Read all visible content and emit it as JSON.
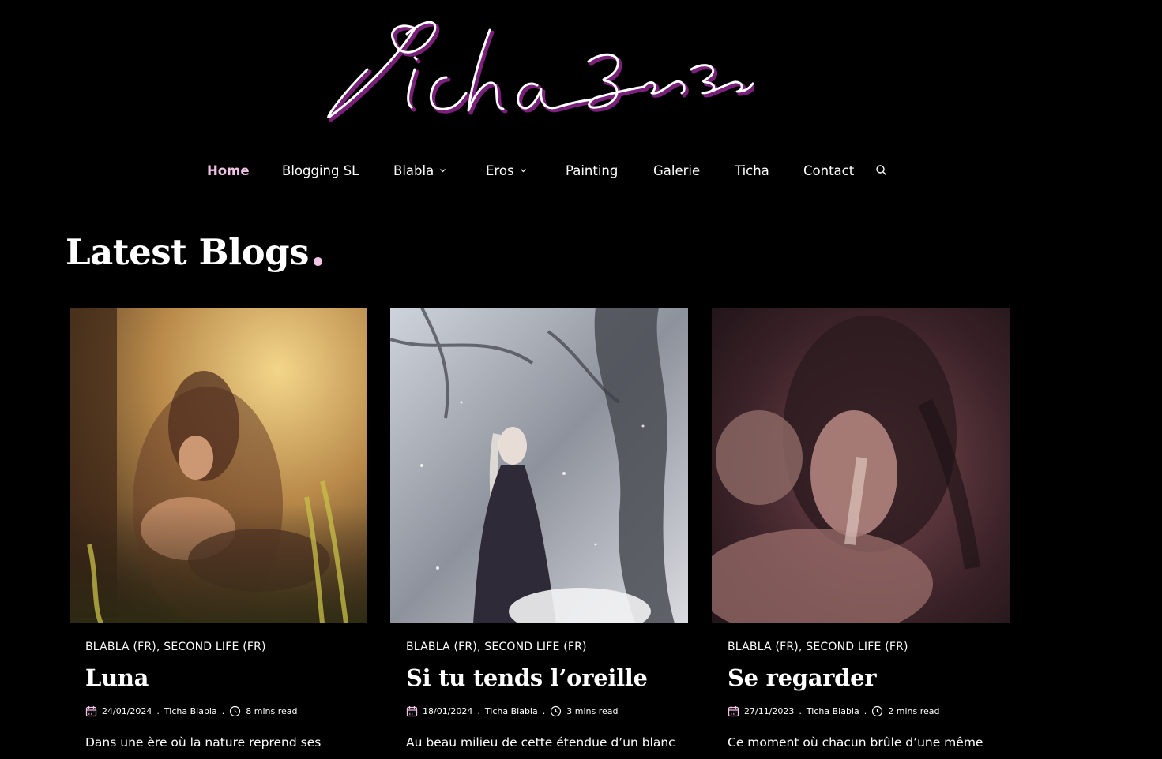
{
  "site": {
    "logo_text": "Ticha Blabla",
    "colors": {
      "background": "#000000",
      "accent": "#f1c3e6",
      "logo_shadow": "#7a1f7a"
    }
  },
  "nav": {
    "items": [
      {
        "label": "Home",
        "active": true
      },
      {
        "label": "Blogging SL"
      },
      {
        "label": "Blabla",
        "has_dropdown": true
      },
      {
        "label": "Eros",
        "has_dropdown": true
      },
      {
        "label": "Painting"
      },
      {
        "label": "Galerie"
      },
      {
        "label": "Ticha"
      },
      {
        "label": "Contact"
      }
    ],
    "search_icon": "search-icon"
  },
  "section": {
    "title": "Latest Blogs"
  },
  "posts": [
    {
      "cat1": "BLABLA (FR)",
      "cat2": "SECOND LIFE (FR)",
      "title": "Luna",
      "date": "24/01/2024",
      "author": "Ticha Blabla",
      "read": "8 mins read",
      "excerpt": "Dans une ère où la nature reprend ses"
    },
    {
      "cat1": "BLABLA (FR)",
      "cat2": "SECOND LIFE (FR)",
      "title": "Si tu tends l’oreille",
      "date": "18/01/2024",
      "author": "Ticha Blabla",
      "read": "3 mins read",
      "excerpt": "Au beau milieu de cette étendue d’un blanc"
    },
    {
      "cat1": "BLABLA (FR)",
      "cat2": "SECOND LIFE (FR)",
      "title": "Se regarder",
      "date": "27/11/2023",
      "author": "Ticha Blabla",
      "read": "2 mins read",
      "excerpt": "Ce moment où chacun brûle d’une même"
    }
  ]
}
